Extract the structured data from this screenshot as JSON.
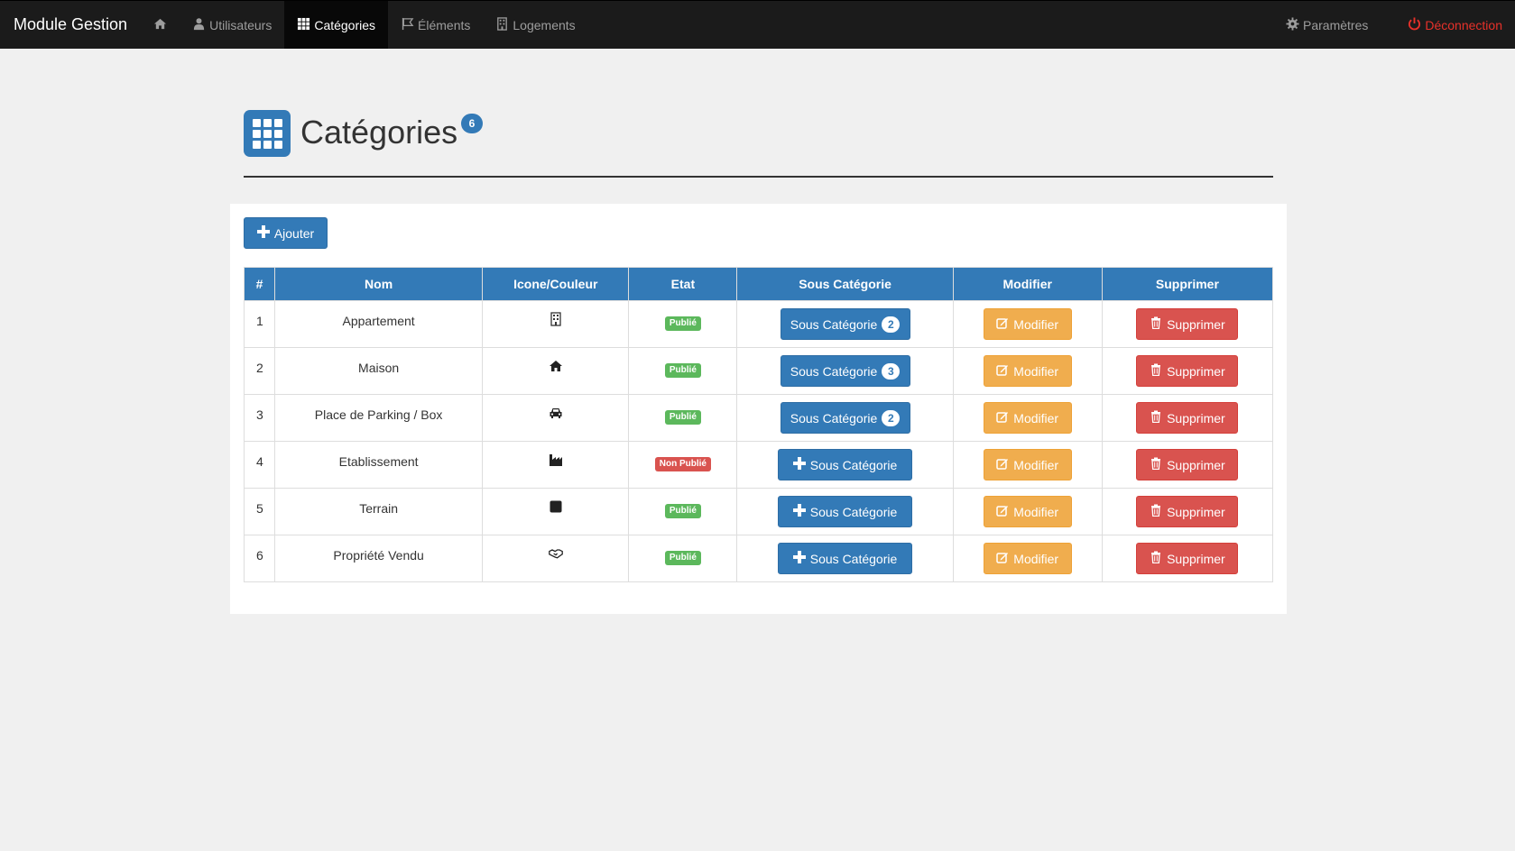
{
  "navbar": {
    "brand": "Module Gestion",
    "items": [
      {
        "label": "",
        "icon": "home-icon"
      },
      {
        "label": "Utilisateurs",
        "icon": "user-icon"
      },
      {
        "label": "Catégories",
        "icon": "grid-icon",
        "active": true
      },
      {
        "label": "Éléments",
        "icon": "flag-icon"
      },
      {
        "label": "Logements",
        "icon": "building-icon"
      }
    ],
    "right": {
      "settings": "Paramètres",
      "logout": "Déconnection"
    }
  },
  "header": {
    "title": "Catégories",
    "count": "6"
  },
  "toolbar": {
    "add_label": "Ajouter"
  },
  "table": {
    "headers": [
      "#",
      "Nom",
      "Icone/Couleur",
      "Etat",
      "Sous Catégorie",
      "Modifier",
      "Supprimer"
    ],
    "rows": [
      {
        "num": "1",
        "name": "Appartement",
        "icon": "building-icon",
        "etat": "Publié",
        "sub_count": "2"
      },
      {
        "num": "2",
        "name": "Maison",
        "icon": "home-icon",
        "etat": "Publié",
        "sub_count": "3"
      },
      {
        "num": "3",
        "name": "Place de Parking / Box",
        "icon": "car-icon",
        "etat": "Publié",
        "sub_count": "2"
      },
      {
        "num": "4",
        "name": "Etablissement",
        "icon": "industry-icon",
        "etat": "Non Publié",
        "sub_count": null
      },
      {
        "num": "5",
        "name": "Terrain",
        "icon": "square-icon",
        "etat": "Publié",
        "sub_count": null
      },
      {
        "num": "6",
        "name": "Propriété Vendu",
        "icon": "handshake-icon",
        "etat": "Publié",
        "sub_count": null
      }
    ],
    "sub_label": "Sous Catégorie",
    "modify_label": "Modifier",
    "delete_label": "Supprimer"
  },
  "colors": {
    "navbar": "#1b1b1b",
    "primary": "#337ab7",
    "success": "#5cb85c",
    "warning": "#f0ad4e",
    "danger": "#d9534f",
    "logout": "#e8312a"
  }
}
